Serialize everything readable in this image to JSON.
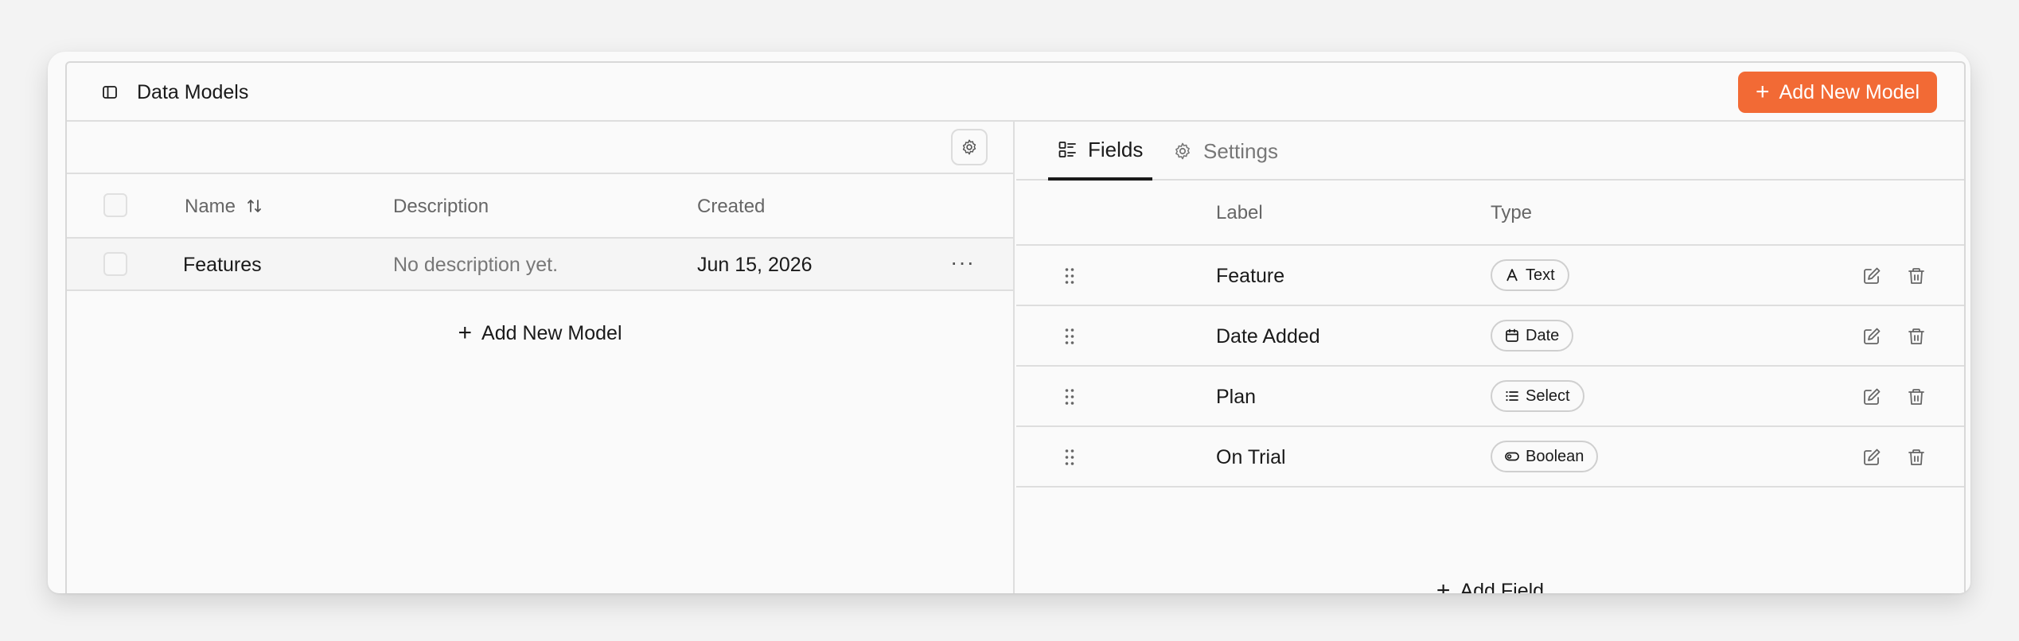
{
  "header": {
    "title": "Data Models",
    "add_button": "Add New Model"
  },
  "models_table": {
    "columns": {
      "name": "Name",
      "description": "Description",
      "created": "Created"
    },
    "rows": [
      {
        "name": "Features",
        "description": "No description yet.",
        "created": "Jun 15, 2026"
      }
    ],
    "add_label": "Add New Model"
  },
  "tabs": {
    "fields": "Fields",
    "settings": "Settings",
    "active": "Fields"
  },
  "fields_table": {
    "columns": {
      "label": "Label",
      "type": "Type"
    },
    "rows": [
      {
        "label": "Feature",
        "type": "Text",
        "icon": "text-type-icon"
      },
      {
        "label": "Date Added",
        "type": "Date",
        "icon": "calendar-icon"
      },
      {
        "label": "Plan",
        "type": "Select",
        "icon": "list-icon"
      },
      {
        "label": "On Trial",
        "type": "Boolean",
        "icon": "toggle-icon"
      }
    ],
    "add_label": "Add Field"
  },
  "colors": {
    "accent": "#f26a35",
    "background": "#fafafa",
    "border": "#dedede"
  }
}
